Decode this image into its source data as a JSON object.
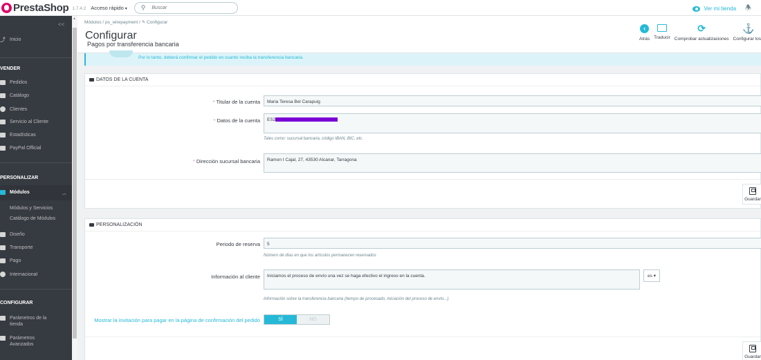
{
  "topbar": {
    "brand": "PrestaShop",
    "version": "1.7.4.2",
    "quick_access": "Acceso rápido",
    "search_placeholder": "Buscar",
    "view_store": "Ver mi tienda"
  },
  "sidebar": {
    "collapse_label": "<<",
    "home": "Inicio",
    "sections": {
      "sell": "VENDER",
      "customize": "PERSONALIZAR",
      "configure": "CONFIGURAR"
    },
    "sell_items": [
      "Pedidos",
      "Catálogo",
      "Clientes",
      "Servicio al Cliente",
      "Estadísticas",
      "PayPal Official"
    ],
    "modules": "Módulos",
    "module_sub": [
      "Módulos y Servicios",
      "Catálogo de Módulos"
    ],
    "customize_items": [
      "Diseño",
      "Transporte",
      "Pago",
      "Internacional"
    ],
    "configure_items": [
      "Parámetros de la tienda",
      "Parámetros Avanzados"
    ]
  },
  "header": {
    "breadcrumb": "Módulos  /  ps_wirepayment  /  ✎ Configurar",
    "title": "Configurar",
    "subtitle": "Pagos por transferencia bancaria",
    "toolbar": [
      "Atrás",
      "Traducir",
      "Comprobar actualizaciones",
      "Configurar los"
    ]
  },
  "alert": {
    "text": "Por lo tanto, deberá confirmar el pedido en cuanto reciba la transferencia bancaria."
  },
  "account_panel": {
    "heading": "DATOS DE LA CUENTA",
    "holder_label": "Titular de la cuenta",
    "holder_value": "Maria Teresa Bel Carapuig",
    "details_label": "Datos de la cuenta",
    "details_value": "ES2",
    "details_help": "Tales como: sucursal bancaria, código IBAN, BIC, etc.",
    "address_label": "Dirección sucursal bancaria",
    "address_value": "Ramon I Cajal, 27, 43530 Alcanar, Tarragona",
    "save_label": "Guardar"
  },
  "custom_panel": {
    "heading": "PERSONALIZACIÓN",
    "reserve_label": "Periodo de reserva",
    "reserve_value": "5",
    "reserve_help": "Número de días en que los artículos permanecen reservados",
    "info_label": "Información al cliente",
    "info_value": "Iniciamos el proceso de envío una vez se haga efectivo el ingreso en la cuenta.",
    "lang": "es",
    "info_help": "Información sobre la transferencia bancaria (tiempo de procesado, iniciación del proceso de envío...)",
    "invite_label": "Mostrar la invitación para pagar en la página de confirmación del pedido",
    "switch_yes": "SÍ",
    "switch_no": "NO",
    "save_label": "Guardar"
  },
  "colors": {
    "accent": "#25b9d7",
    "sidebar_bg": "#363a41",
    "brand": "#df0067",
    "redaction": "#7b00d6"
  }
}
